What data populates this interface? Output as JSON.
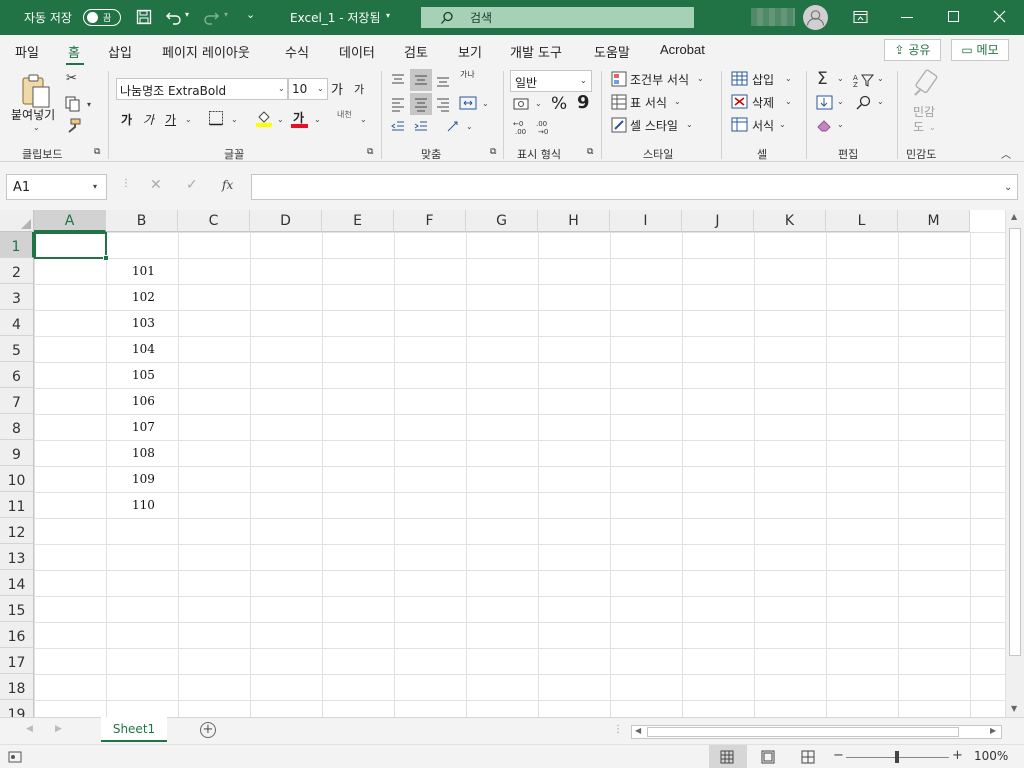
{
  "titlebar": {
    "autosave_label": "자동 저장",
    "autosave_state": "끔",
    "doc_title": "Excel_1 - 저장됨",
    "search_placeholder": "검색"
  },
  "menu": {
    "tabs": [
      "파일",
      "홈",
      "삽입",
      "페이지 레이아웃",
      "수식",
      "데이터",
      "검토",
      "보기",
      "개발 도구",
      "도움말",
      "Acrobat"
    ],
    "active_tab": "홈",
    "share_label": "공유",
    "memo_label": "메모"
  },
  "ribbon": {
    "clipboard": {
      "paste_label": "붙여넣기",
      "group_label": "클립보드"
    },
    "font": {
      "font_name": "나눔명조 ExtraBold",
      "font_size": "10",
      "bold": "가",
      "italic": "가",
      "underline": "가",
      "grow": "가",
      "shrink": "가",
      "font_color_label": "가",
      "phonetic": "내천",
      "group_label": "글꼴"
    },
    "alignment": {
      "group_label": "맞춤",
      "wrap_label": "가나"
    },
    "number": {
      "format": "일반",
      "percent": "%",
      "comma": "9",
      "group_label": "표시 형식"
    },
    "styles": {
      "conditional": "조건부 서식",
      "table": "표 서식",
      "cell_styles": "셀 스타일",
      "group_label": "스타일"
    },
    "cells": {
      "insert": "삽입",
      "delete": "삭제",
      "format": "서식",
      "group_label": "셀"
    },
    "editing": {
      "group_label": "편집"
    },
    "sensitivity": {
      "label1": "민감",
      "label2": "도",
      "group_label": "민감도"
    }
  },
  "formula_bar": {
    "name_box": "A1",
    "fx": "fx",
    "content": ""
  },
  "grid": {
    "columns": [
      "A",
      "B",
      "C",
      "D",
      "E",
      "F",
      "G",
      "H",
      "I",
      "J",
      "K",
      "L",
      "M"
    ],
    "rows": [
      "1",
      "2",
      "3",
      "4",
      "5",
      "6",
      "7",
      "8",
      "9",
      "10",
      "11",
      "12",
      "13",
      "14",
      "15",
      "16",
      "17",
      "18",
      "19"
    ],
    "selected_cell": "A1",
    "values": {
      "B2": "101",
      "B3": "102",
      "B4": "103",
      "B5": "104",
      "B6": "105",
      "B7": "106",
      "B8": "107",
      "B9": "108",
      "B10": "109",
      "B11": "110"
    }
  },
  "sheets": {
    "tabs": [
      "Sheet1"
    ],
    "active": "Sheet1",
    "add_label": "+"
  },
  "status": {
    "zoom": "100%",
    "minus": "−",
    "plus": "+"
  },
  "colors": {
    "brand": "#217346",
    "ribbon_bg": "#f3f3f3",
    "grid_line": "#e1e1e1"
  }
}
